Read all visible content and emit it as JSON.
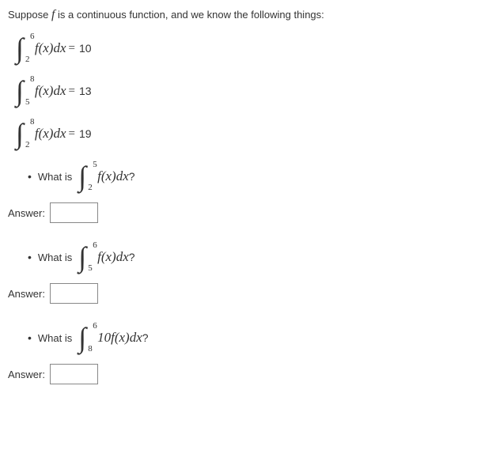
{
  "intro": {
    "prefix": "Suppose ",
    "f": "f",
    "suffix": " is a continuous function, and we know the following things:"
  },
  "givens": [
    {
      "lower": "2",
      "upper": "6",
      "integrand": "f(x)dx",
      "value": "10"
    },
    {
      "lower": "5",
      "upper": "8",
      "integrand": "f(x)dx",
      "value": "13"
    },
    {
      "lower": "2",
      "upper": "8",
      "integrand": "f(x)dx",
      "value": "19"
    }
  ],
  "questions": [
    {
      "what": "What is",
      "lower": "2",
      "upper": "5",
      "integrand": "f(x)dx",
      "q": "?",
      "answer": "Answer:"
    },
    {
      "what": "What is",
      "lower": "5",
      "upper": "6",
      "integrand": "f(x)dx",
      "q": "?",
      "answer": "Answer:"
    },
    {
      "what": "What is",
      "lower": "8",
      "upper": "6",
      "integrand": "10f(x)dx",
      "q": "?",
      "answer": "Answer:"
    }
  ]
}
